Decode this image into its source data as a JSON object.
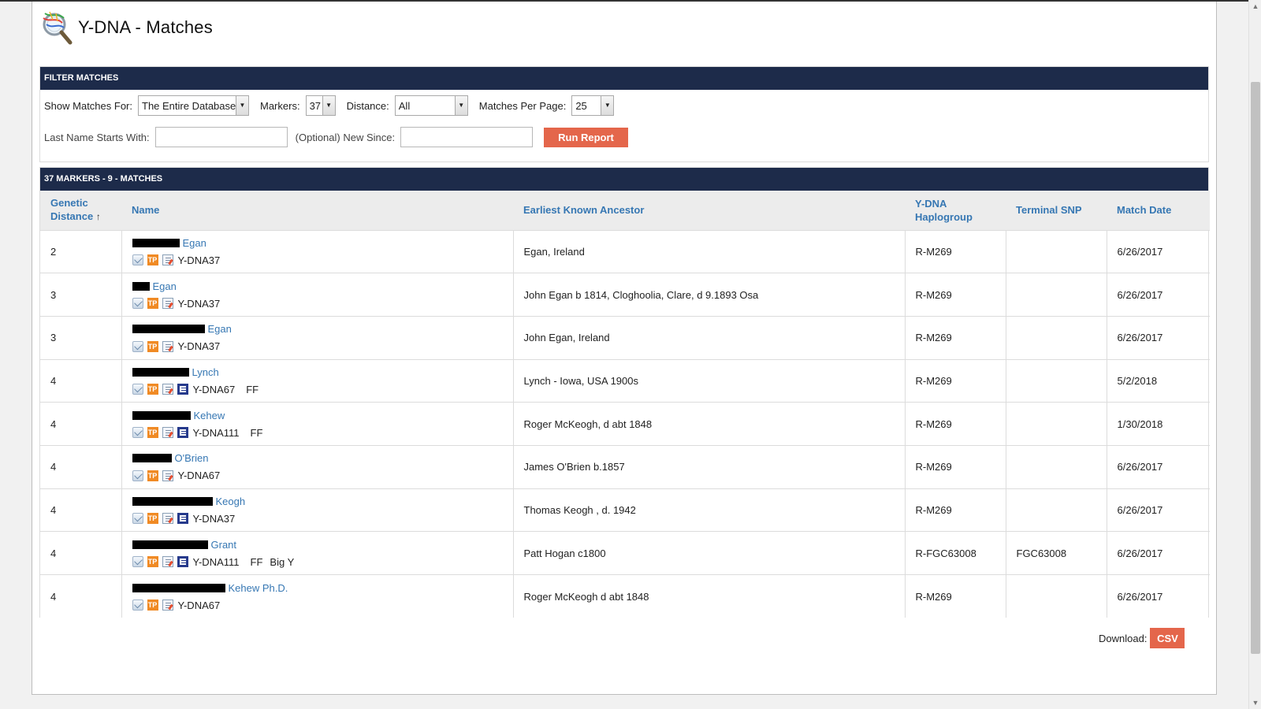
{
  "page": {
    "title": "Y-DNA - Matches"
  },
  "filter": {
    "header": "FILTER MATCHES",
    "show_matches_label": "Show Matches For:",
    "show_matches_value": "The Entire Database",
    "markers_label": "Markers:",
    "markers_value": "37",
    "distance_label": "Distance:",
    "distance_value": "All",
    "per_page_label": "Matches Per Page:",
    "per_page_value": "25",
    "last_name_label": "Last Name Starts With:",
    "last_name_value": "",
    "new_since_label": "(Optional) New Since:",
    "new_since_value": "",
    "run_label": "Run Report"
  },
  "results": {
    "header": "37 MARKERS - 9 - MATCHES",
    "columns": {
      "genetic_distance": "Genetic",
      "genetic_distance_2": "Distance",
      "sort_indicator": "↑",
      "name": "Name",
      "ancestor": "Earliest Known Ancestor",
      "haplogroup": "Y-DNA",
      "haplogroup_2": "Haplogroup",
      "snp": "Terminal SNP",
      "date": "Match Date"
    },
    "rows": [
      {
        "distance": "2",
        "surname": "Egan",
        "test": "Y-DNA37",
        "ff": "",
        "bigy": "",
        "ancestor": "Egan, Ireland",
        "haplogroup": "R-M269",
        "snp": "",
        "date": "6/26/2017"
      },
      {
        "distance": "3",
        "surname": "Egan",
        "test": "Y-DNA37",
        "ff": "",
        "bigy": "",
        "ancestor": "John Egan b 1814, Cloghoolia, Clare, d 9.1893 Osa",
        "haplogroup": "R-M269",
        "snp": "",
        "date": "6/26/2017"
      },
      {
        "distance": "3",
        "surname": "Egan",
        "test": "Y-DNA37",
        "ff": "",
        "bigy": "",
        "ancestor": "John Egan, Ireland",
        "haplogroup": "R-M269",
        "snp": "",
        "date": "6/26/2017"
      },
      {
        "distance": "4",
        "surname": "Lynch",
        "test": "Y-DNA67",
        "ff": "FF",
        "bigy": "",
        "ancestor": "Lynch - Iowa, USA 1900s",
        "haplogroup": "R-M269",
        "snp": "",
        "date": "5/2/2018"
      },
      {
        "distance": "4",
        "surname": "Kehew",
        "test": "Y-DNA111",
        "ff": "FF",
        "bigy": "",
        "ancestor": "Roger McKeogh, d abt 1848",
        "haplogroup": "R-M269",
        "snp": "",
        "date": "1/30/2018"
      },
      {
        "distance": "4",
        "surname": "O'Brien",
        "test": "Y-DNA67",
        "ff": "",
        "bigy": "",
        "ancestor": "James O'Brien b.1857",
        "haplogroup": "R-M269",
        "snp": "",
        "date": "6/26/2017"
      },
      {
        "distance": "4",
        "surname": "Keogh",
        "test": "Y-DNA37",
        "ff": "",
        "bigy": "",
        "ancestor": "Thomas Keogh , d. 1942",
        "haplogroup": "R-M269",
        "snp": "",
        "date": "6/26/2017"
      },
      {
        "distance": "4",
        "surname": "Grant",
        "test": "Y-DNA111",
        "ff": "FF",
        "bigy": "Big Y",
        "ancestor": "Patt Hogan c1800",
        "haplogroup": "R-FGC63008",
        "snp": "FGC63008",
        "date": "6/26/2017"
      },
      {
        "distance": "4",
        "surname": "Kehew Ph.D.",
        "test": "Y-DNA67",
        "ff": "",
        "bigy": "",
        "ancestor": "Roger McKeogh d abt 1848",
        "haplogroup": "R-M269",
        "snp": "",
        "date": "6/26/2017"
      }
    ]
  },
  "download": {
    "label": "Download:",
    "csv_label": "CSV"
  },
  "icons": {
    "logo": "dna-magnifier-logo",
    "mail": "envelope-icon",
    "tree": "family-tree-icon",
    "notes": "notes-icon",
    "haplo": "haplotree-icon"
  },
  "colors": {
    "header_bg": "#1d2b4a",
    "accent": "#e4664b",
    "link": "#3677b3"
  }
}
